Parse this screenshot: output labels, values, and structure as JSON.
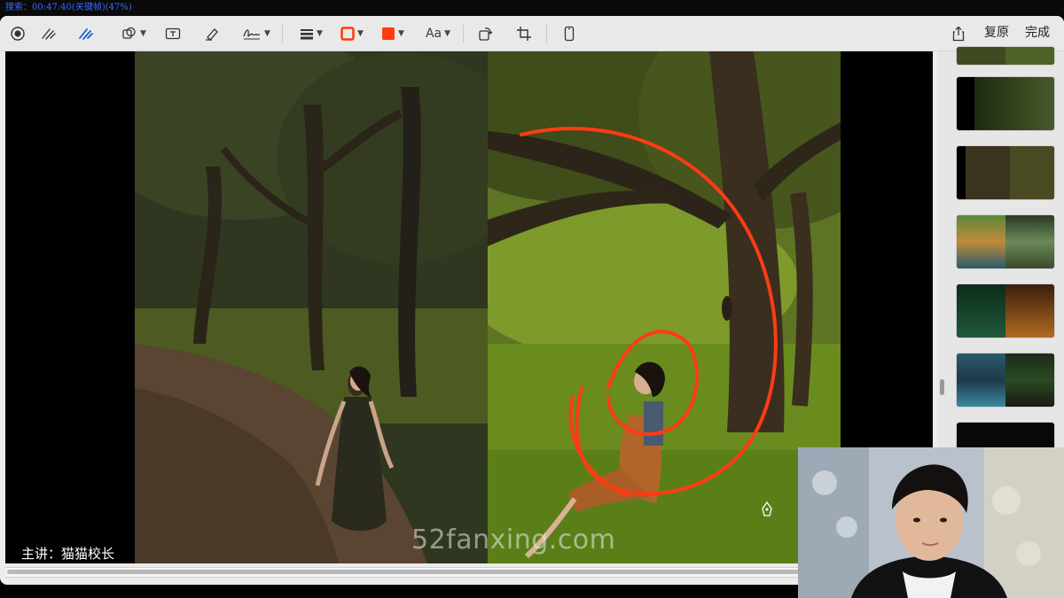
{
  "status_bar": {
    "text": "搜索：00:47:40(关键帧)(47%)"
  },
  "toolbar": {
    "tools": [
      {
        "name": "record-icon"
      },
      {
        "name": "sketch-icon"
      },
      {
        "name": "draw-icon"
      },
      {
        "name": "shapes-icon"
      },
      {
        "name": "text-box-icon"
      },
      {
        "name": "highlight-icon"
      },
      {
        "name": "signature-icon"
      },
      {
        "name": "line-style-icon"
      },
      {
        "name": "border-color-icon"
      },
      {
        "name": "fill-color-icon"
      },
      {
        "name": "rotate-icon"
      },
      {
        "name": "crop-icon"
      },
      {
        "name": "device-icon"
      }
    ],
    "font_label": "Aa",
    "revert_label": "复原",
    "done_label": "完成"
  },
  "colors": {
    "annotation": "#ff3b14",
    "accent_blue": "#1a5fd1",
    "toolbar_bg": "#e9e9e9"
  },
  "canvas": {
    "caption": "主讲：猫猫校长",
    "watermark": "52fanxing.com"
  },
  "sidebar": {
    "thumbnails": [
      {
        "label": ""
      },
      {
        "label": ""
      },
      {
        "label": ""
      },
      {
        "label": ""
      },
      {
        "label": ""
      },
      {
        "label": ""
      },
      {
        "label": ""
      }
    ]
  }
}
